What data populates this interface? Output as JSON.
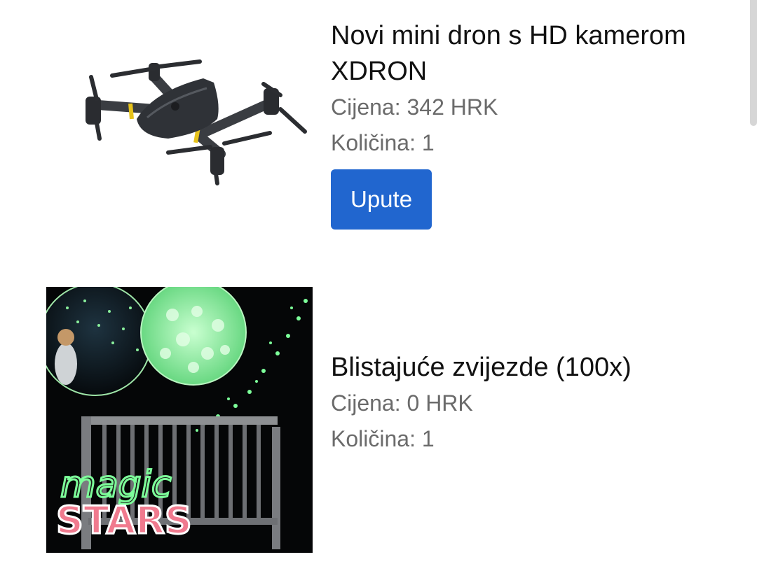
{
  "products": [
    {
      "name": "Novi mini dron s HD kamerom XDRON",
      "price": "Cijena: 342 HRK",
      "quantity": "Količina: 1",
      "button_label": "Upute",
      "image_icon": "drone-product-image"
    },
    {
      "name": "Blistajuće zvijezde (100x)",
      "price": "Cijena: 0 HRK",
      "quantity": "Količina: 1",
      "image_icon": "glow-stars-product-image",
      "image_text": {
        "script": "magic",
        "headline": "STARS"
      }
    }
  ],
  "colors": {
    "button": "#2166cf",
    "title": "#111111",
    "meta": "#6b6b6b",
    "glow": "#7dff9a",
    "stars_pink": "#f07a8e"
  }
}
